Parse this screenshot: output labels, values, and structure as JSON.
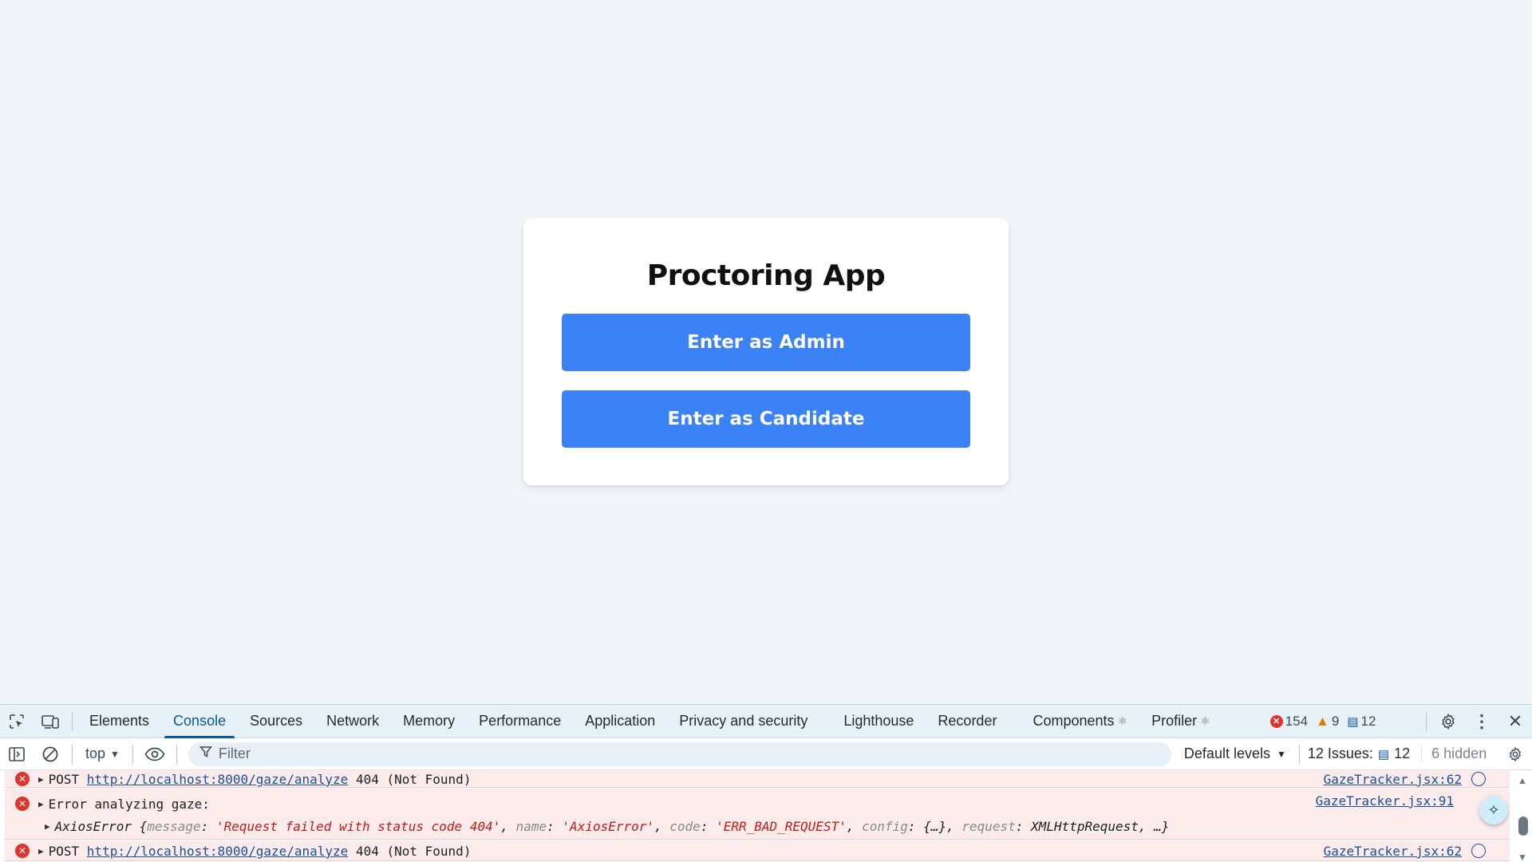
{
  "app": {
    "title": "Proctoring App",
    "buttons": {
      "admin": "Enter as Admin",
      "candidate": "Enter as Candidate"
    },
    "colors": {
      "primary": "#3b82f6",
      "background": "#f3f4f6",
      "card": "#ffffff"
    }
  },
  "devtools": {
    "tabs": [
      {
        "label": "Elements"
      },
      {
        "label": "Console"
      },
      {
        "label": "Sources"
      },
      {
        "label": "Network"
      },
      {
        "label": "Memory"
      },
      {
        "label": "Performance"
      },
      {
        "label": "Application"
      },
      {
        "label": "Privacy and security"
      },
      {
        "label": "Lighthouse"
      },
      {
        "label": "Recorder"
      },
      {
        "label": "Components"
      },
      {
        "label": "Profiler"
      }
    ],
    "active_tab": "Console",
    "counters": {
      "errors": "154",
      "warnings": "9",
      "messages": "12"
    },
    "toolbar": {
      "context": "top",
      "filter_placeholder": "Filter",
      "levels": "Default levels",
      "issues_label": "12 Issues:",
      "issues_count": "12",
      "hidden": "6 hidden"
    },
    "logs": [
      {
        "method": "POST",
        "url": "http://localhost:8000/gaze/analyze",
        "status": "404 (Not Found)",
        "source": "GazeTracker.jsx:62"
      },
      {
        "message": "Error analyzing gaze:",
        "source": "GazeTracker.jsx:91",
        "detail": {
          "class": "AxiosError",
          "open": "{",
          "k_message": "message",
          "v_message": "'Request failed with status code 404'",
          "k_name": "name",
          "v_name": "'AxiosError'",
          "k_code": "code",
          "v_code": "'ERR_BAD_REQUEST'",
          "k_config": "config",
          "v_config": "{…}",
          "k_request": "request",
          "v_request": "XMLHttpRequest",
          "tail": ", …}"
        }
      },
      {
        "method": "POST",
        "url": "http://localhost:8000/gaze/analyze",
        "status": "404 (Not Found)",
        "source": "GazeTracker.jsx:62"
      }
    ]
  }
}
